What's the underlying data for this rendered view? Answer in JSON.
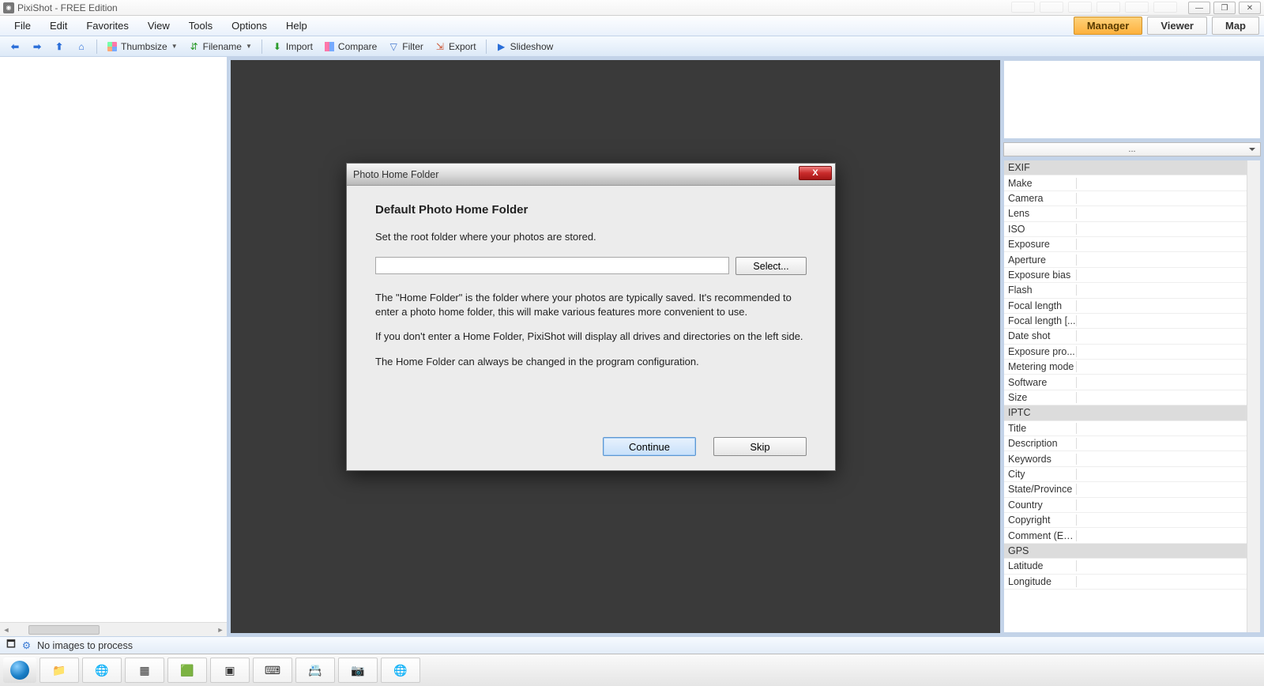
{
  "title_bar": {
    "app_title": "PixiShot  -  FREE Edition"
  },
  "window_controls": {
    "min": "—",
    "max": "❐",
    "close": "✕"
  },
  "menu": {
    "file": "File",
    "edit": "Edit",
    "favorites": "Favorites",
    "view": "View",
    "tools": "Tools",
    "options": "Options",
    "help": "Help"
  },
  "modes": {
    "manager": "Manager",
    "viewer": "Viewer",
    "map": "Map"
  },
  "toolbar": {
    "thumbsize": "Thumbsize",
    "filename": "Filename",
    "import": "Import",
    "compare": "Compare",
    "filter": "Filter",
    "export": "Export",
    "slideshow": "Slideshow"
  },
  "right_dropdown": {
    "label": "..."
  },
  "props": {
    "sections": [
      {
        "header": "EXIF",
        "rows": [
          "Make",
          "Camera",
          "Lens",
          "ISO",
          "Exposure",
          "Aperture",
          "Exposure bias",
          "Flash",
          "Focal length",
          "Focal length [...",
          "Date shot",
          "Exposure pro...",
          "Metering mode",
          "Software",
          "Size"
        ]
      },
      {
        "header": "IPTC",
        "rows": [
          "Title",
          "Description",
          "Keywords",
          "City",
          "State/Province",
          "Country",
          "Copyright",
          "Comment (Exif)"
        ]
      },
      {
        "header": "GPS",
        "rows": [
          "Latitude",
          "Longitude"
        ]
      }
    ]
  },
  "status": {
    "idle_icon": "idle",
    "process_text": "No images to process"
  },
  "dialog": {
    "title": "Photo Home Folder",
    "heading": "Default Photo Home Folder",
    "subhead": "Set the root folder where your photos are stored.",
    "select_btn": "Select...",
    "p1": "The \"Home Folder\" is the folder where your photos are typically saved. It's recommended to enter a photo home folder, this will make various features more convenient to use.",
    "p2": "If you don't enter a Home Folder, PixiShot will display all drives and directories on the left side.",
    "p3": "The Home Folder can always be changed in the program configuration.",
    "continue": "Continue",
    "skip": "Skip",
    "close_x": "X"
  }
}
